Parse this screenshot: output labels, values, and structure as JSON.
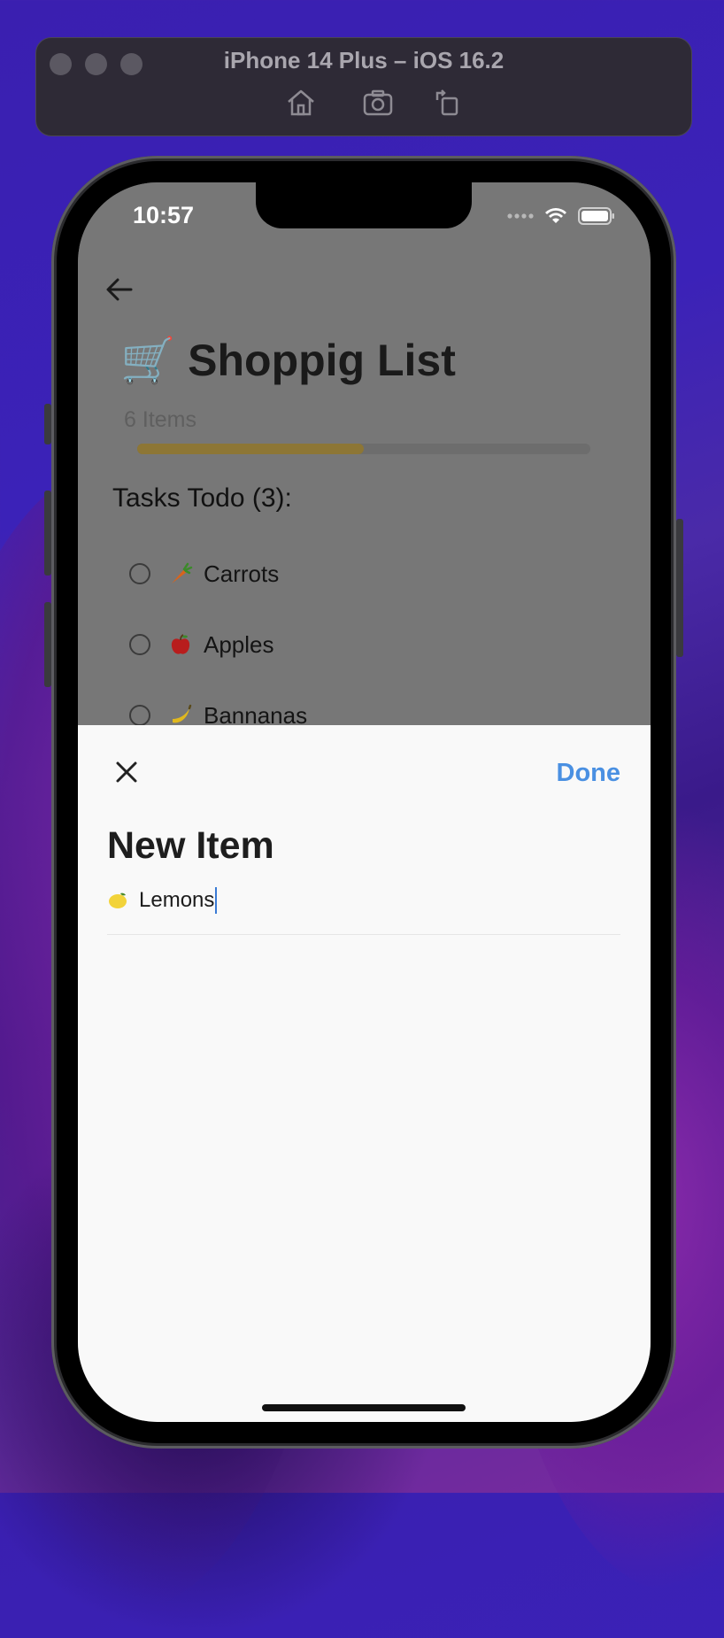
{
  "simulator": {
    "title": "iPhone 14 Plus – iOS 16.2",
    "toolbar_icons": [
      "home-icon",
      "screenshot-icon",
      "rotate-icon"
    ]
  },
  "status_bar": {
    "time": "10:57",
    "icons": [
      "cellular-icon",
      "wifi-icon",
      "battery-icon"
    ]
  },
  "list": {
    "title": "🛒 Shoppig List",
    "item_count": "6 Items",
    "progress_fraction": 0.5,
    "section_header": "Tasks Todo (3):",
    "tasks": [
      {
        "emoji": "carrot-icon",
        "label": "Carrots"
      },
      {
        "emoji": "apple-icon",
        "label": "Apples"
      },
      {
        "emoji": "banana-icon",
        "label": "Bannanas"
      }
    ]
  },
  "sheet": {
    "done_label": "Done",
    "title": "New Item",
    "input_value": "Lemons"
  },
  "colors": {
    "accent": "#4a90e2",
    "progress": "#8d7635",
    "overlay": "#777777",
    "sheet": "#f9f9f9"
  }
}
